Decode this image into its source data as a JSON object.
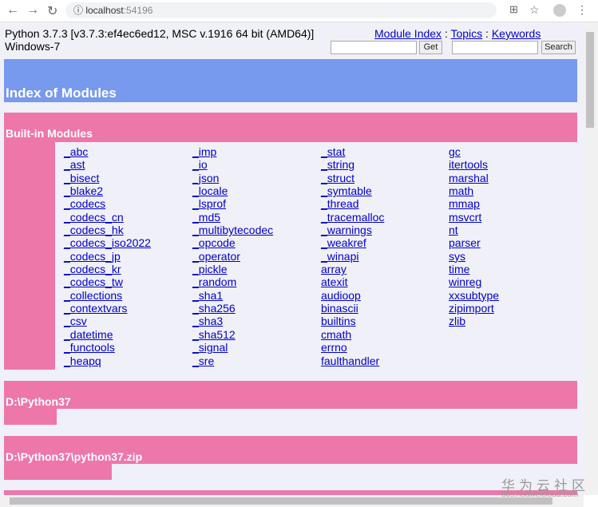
{
  "browser": {
    "url_host": "localhost",
    "url_port": ":54196"
  },
  "header": {
    "python_version": "Python 3.7.3 [v3.7.3:ef4ec6ed12, MSC v.1916 64 bit (AMD64)]",
    "platform": "Windows-7",
    "links": [
      "Module Index",
      "Topics",
      "Keywords"
    ],
    "separator": " : ",
    "get_label": "Get",
    "search_label": "Search"
  },
  "index_title": "Index of Modules",
  "builtin_title": "Built-in Modules",
  "builtin_columns": [
    [
      "_abc",
      "_ast",
      "_bisect",
      "_blake2",
      "_codecs",
      "_codecs_cn",
      "_codecs_hk",
      "_codecs_iso2022",
      "_codecs_jp",
      "_codecs_kr",
      "_codecs_tw",
      "_collections",
      "_contextvars",
      "_csv",
      "_datetime",
      "_functools",
      "_heapq"
    ],
    [
      "_imp",
      "_io",
      "_json",
      "_locale",
      "_lsprof",
      "_md5",
      "_multibytecodec",
      "_opcode",
      "_operator",
      "_pickle",
      "_random",
      "_sha1",
      "_sha256",
      "_sha3",
      "_sha512",
      "_signal",
      "_sre"
    ],
    [
      "_stat",
      "_string",
      "_struct",
      "_symtable",
      "_thread",
      "_tracemalloc",
      "_warnings",
      "_weakref",
      "_winapi",
      "array",
      "atexit",
      "audioop",
      "binascii",
      "builtins",
      "cmath",
      "errno",
      "faulthandler"
    ],
    [
      "gc",
      "itertools",
      "marshal",
      "math",
      "mmap",
      "msvcrt",
      "nt",
      "parser",
      "sys",
      "time",
      "winreg",
      "xxsubtype",
      "zipimport",
      "zlib"
    ]
  ],
  "sections": [
    "D:\\Python37",
    "D:\\Python37\\python37.zip"
  ],
  "watermark": {
    "cn": "华为云社区",
    "url": "bbs.huaweicloud.com"
  }
}
